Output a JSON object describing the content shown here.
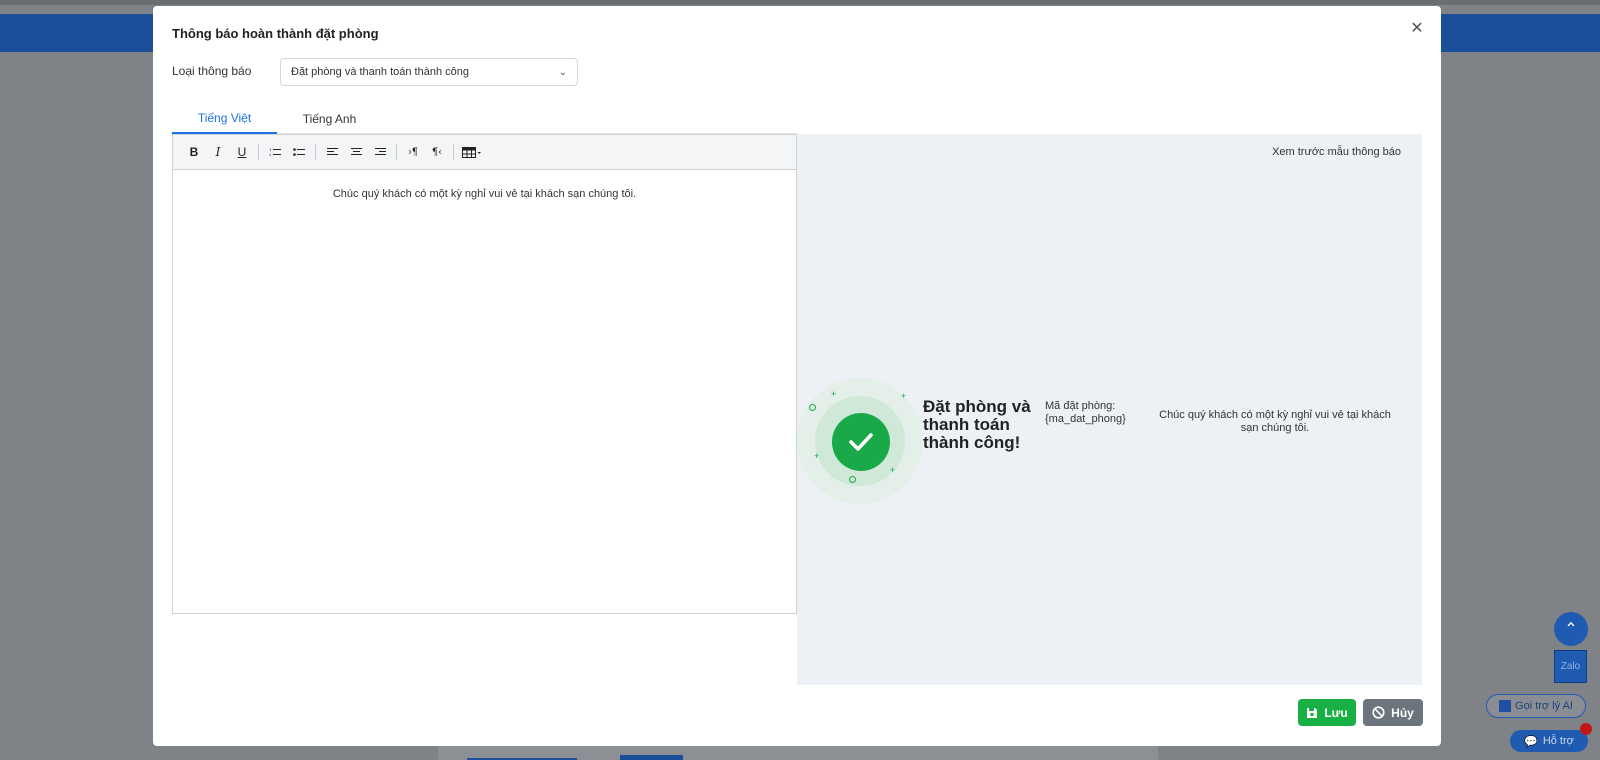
{
  "modal": {
    "title": "Thông báo hoàn thành đặt phòng",
    "close_icon": "close-icon"
  },
  "notification_type": {
    "label": "Loại thông báo",
    "selected": "Đặt phòng và thanh toán thành công"
  },
  "tabs": [
    {
      "label": "Tiếng Việt",
      "active": true
    },
    {
      "label": "Tiếng Anh",
      "active": false
    }
  ],
  "editor": {
    "toolbar": [
      "bold-icon",
      "italic-icon",
      "underline-icon",
      "ordered-list-icon",
      "unordered-list-icon",
      "align-left-icon",
      "align-center-icon",
      "align-right-icon",
      "ltr-icon",
      "rtl-icon",
      "table-icon"
    ],
    "content": "Chúc quý khách có một kỳ nghỉ vui vẻ tại khách sạn chúng tôi."
  },
  "preview": {
    "label": "Xem trước mẫu thông báo",
    "success_title": "Đặt phòng và thanh toán thành công!",
    "booking_code_label": "Mã đặt phòng:",
    "booking_code_value": "{ma_dat_phong}",
    "message": "Chúc quý khách có một kỳ nghỉ vui vẻ tại khách sạn chúng tôi.",
    "accent_color": "#1aa948"
  },
  "actions": {
    "save_label": "Lưu",
    "cancel_label": "Hủy"
  },
  "floating": {
    "zalo_label": "Zalo",
    "ai_label": "Gọi trợ lý AI",
    "help_label": "Hỗ trợ"
  }
}
